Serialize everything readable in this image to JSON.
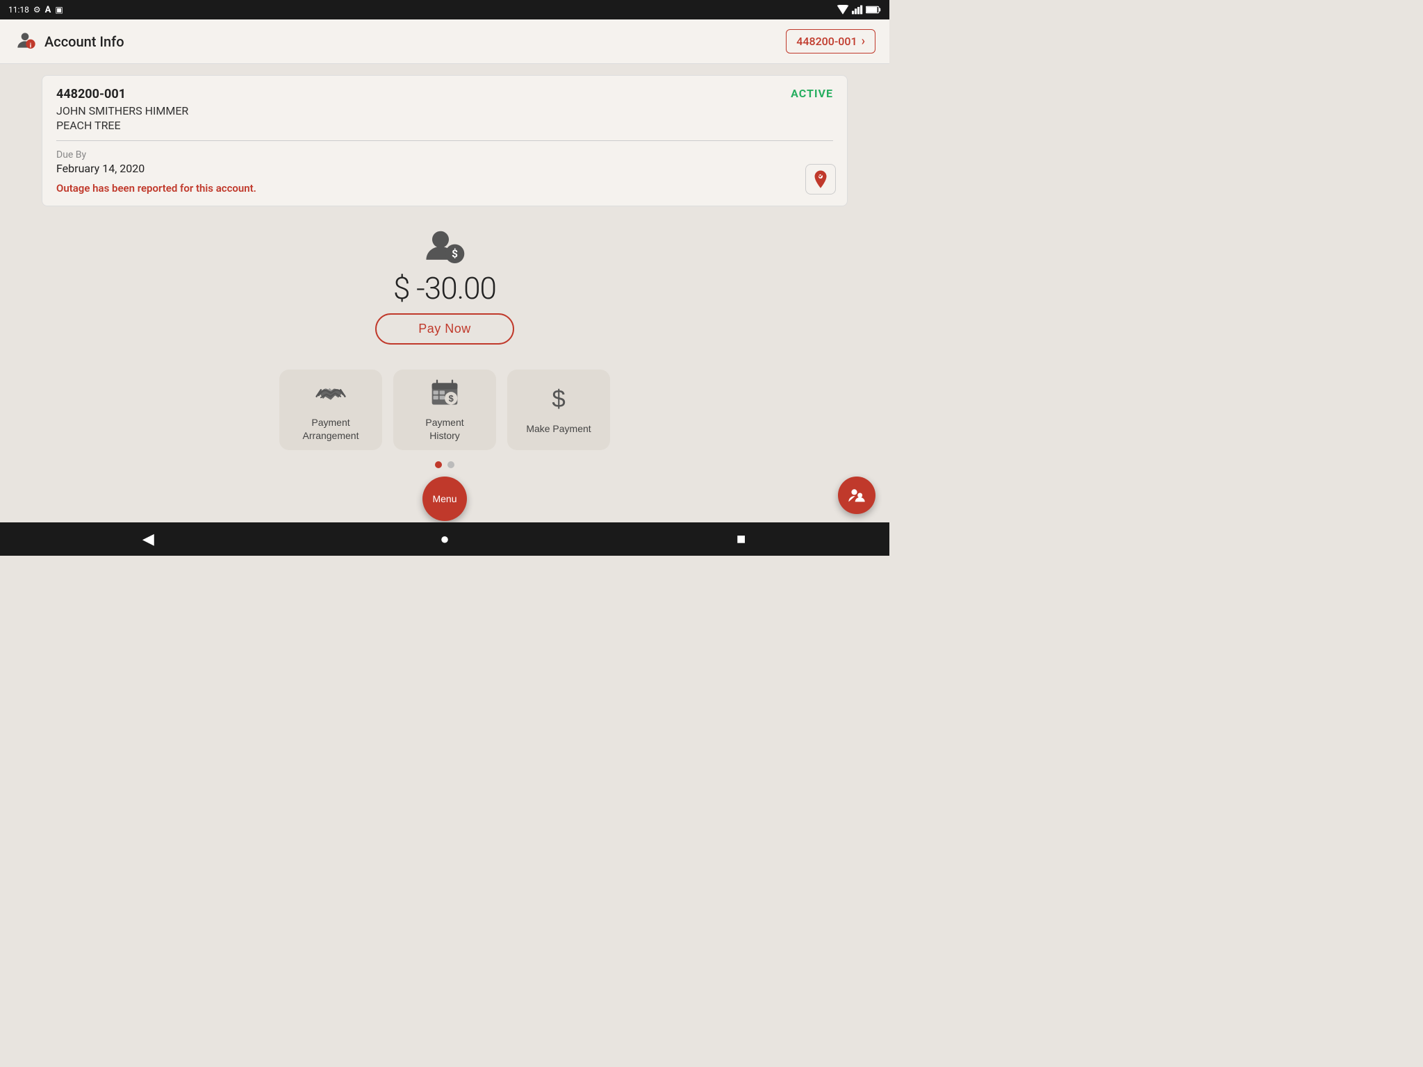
{
  "statusBar": {
    "time": "11:18",
    "icons": [
      "settings-icon",
      "accessibility-icon",
      "sim-icon"
    ]
  },
  "header": {
    "title": "Account Info",
    "accountBadge": "448200-001",
    "chevron": "›"
  },
  "accountCard": {
    "accountNumber": "448200-001",
    "status": "ACTIVE",
    "name": "JOHN SMITHERS HIMMER",
    "location": "PEACH TREE",
    "dueByLabel": "Due By",
    "dueDate": "February 14, 2020",
    "outageNotice": "Outage has been reported for this account."
  },
  "balance": {
    "amount": "$ -30.00"
  },
  "payNow": {
    "label": "Pay Now"
  },
  "actions": [
    {
      "id": "payment-arrangement",
      "label": "Payment\nArrangement",
      "icon": "handshake-icon"
    },
    {
      "id": "payment-history",
      "label": "Payment\nHistory",
      "icon": "calendar-dollar-icon"
    },
    {
      "id": "make-payment",
      "label": "Make Payment",
      "icon": "dollar-sign-icon"
    }
  ],
  "menu": {
    "label": "Menu"
  },
  "pagination": {
    "dots": [
      true,
      false
    ]
  },
  "nav": {
    "back": "◀",
    "home": "●",
    "recents": "■"
  }
}
